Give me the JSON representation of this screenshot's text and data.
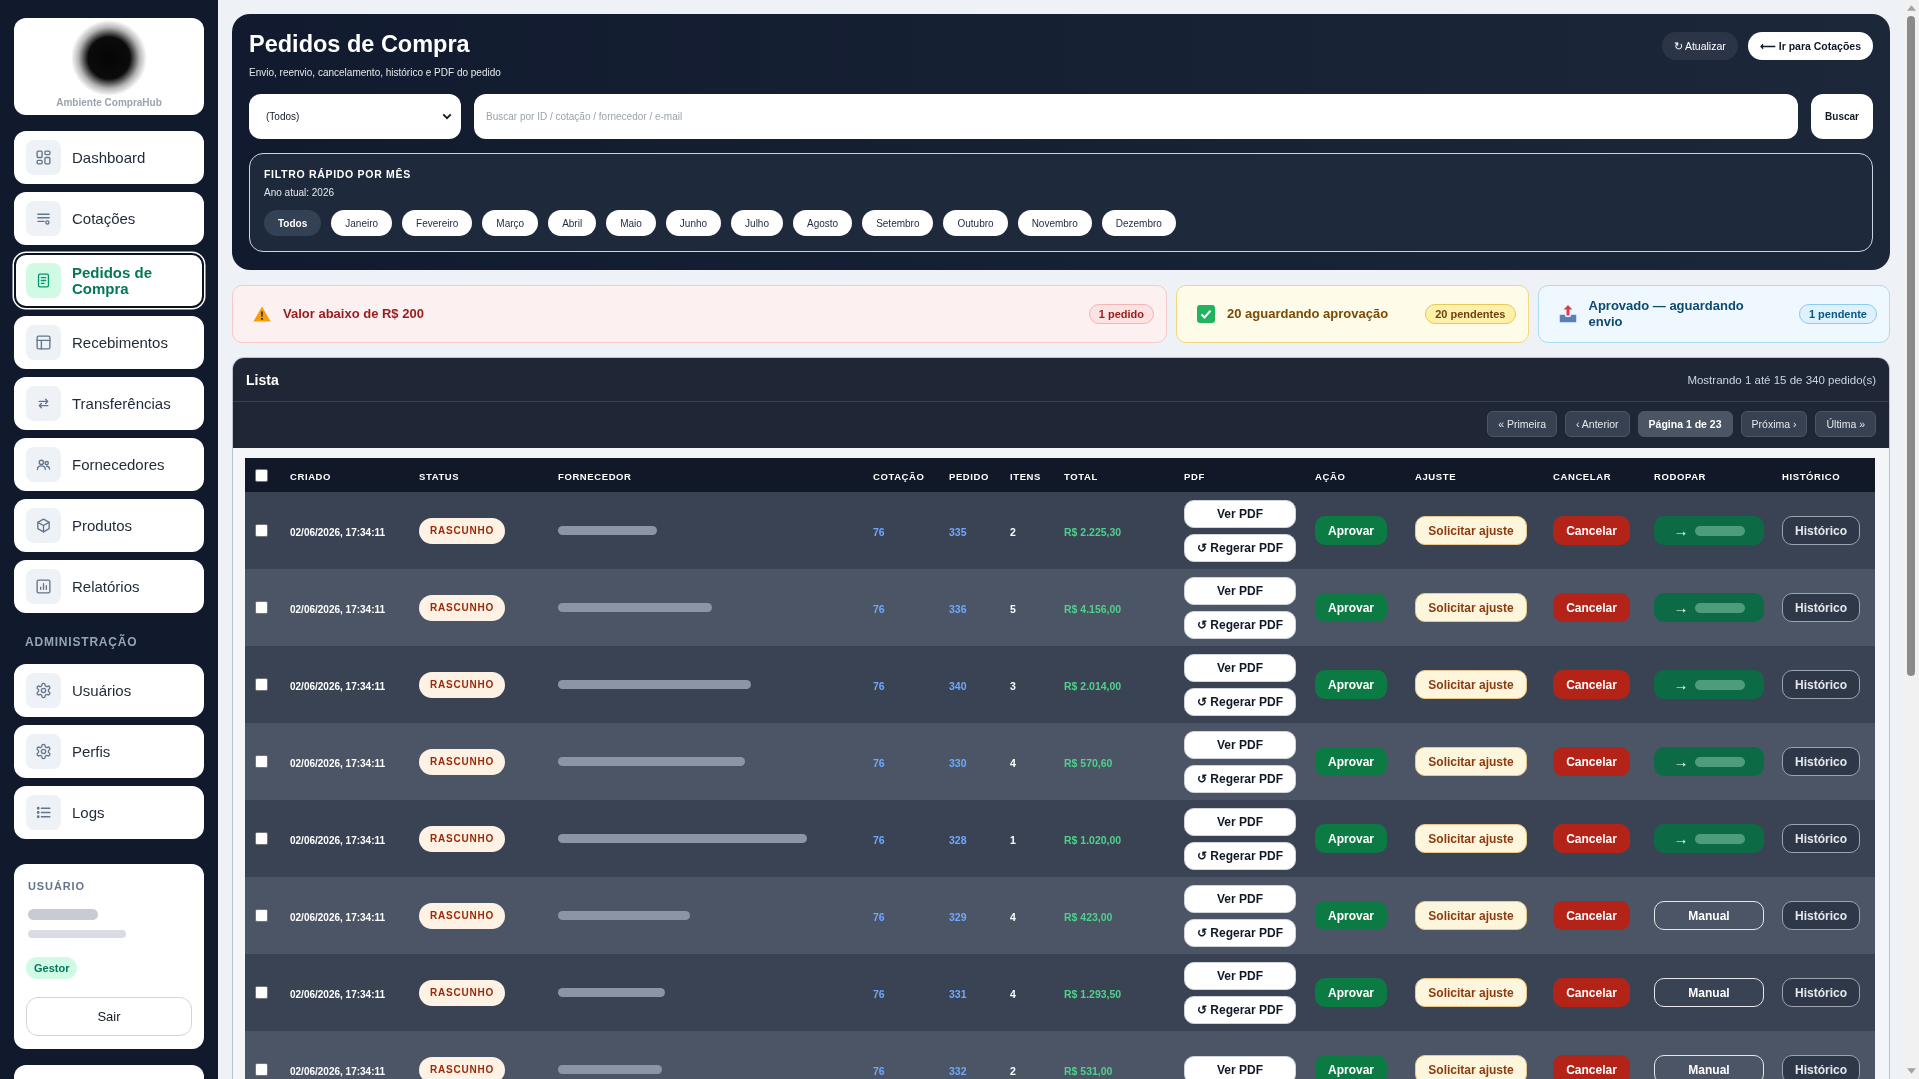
{
  "sidebar": {
    "brand_caption": "Ambiente CompraHub",
    "sections": [
      {
        "items": [
          {
            "label": "Dashboard",
            "selected": false
          },
          {
            "label": "Cotações",
            "selected": false
          },
          {
            "label": "Pedidos de Compra",
            "selected": true
          },
          {
            "label": "Recebimentos",
            "selected": false
          },
          {
            "label": "Transferências",
            "selected": false
          },
          {
            "label": "Fornecedores",
            "selected": false
          },
          {
            "label": "Produtos",
            "selected": false
          },
          {
            "label": "Relatórios",
            "selected": false
          }
        ]
      },
      {
        "heading": "ADMINISTRAÇÃO",
        "items": [
          {
            "label": "Usuários",
            "selected": false
          },
          {
            "label": "Perfis",
            "selected": false
          },
          {
            "label": "Logs",
            "selected": false
          }
        ]
      }
    ],
    "user": {
      "heading": "USUÁRIO",
      "role": "Gestor",
      "logout": "Sair"
    }
  },
  "header": {
    "title": "Pedidos de Compra",
    "subtitle": "Envio, reenvio, cancelamento, histórico e PDF do pedido",
    "actions": [
      {
        "kind": "dark",
        "label": "↻ Atualizar"
      },
      {
        "kind": "light",
        "label": "⟵ Ir para Cotações"
      }
    ],
    "status_select": {
      "value": "(Todos)"
    },
    "search": {
      "placeholder": "Buscar por ID / cotação / fornecedor / e-mail",
      "button": "Buscar"
    },
    "month_filter": {
      "heading": "FILTRO RÁPIDO POR MÊS",
      "year_note": "Ano atual: 2026",
      "months": [
        {
          "label": "Todos",
          "selected": true
        },
        {
          "label": "Janeiro",
          "selected": false
        },
        {
          "label": "Fevereiro",
          "selected": false
        },
        {
          "label": "Março",
          "selected": false
        },
        {
          "label": "Abril",
          "selected": false
        },
        {
          "label": "Maio",
          "selected": false
        },
        {
          "label": "Junho",
          "selected": false
        },
        {
          "label": "Julho",
          "selected": false
        },
        {
          "label": "Agosto",
          "selected": false
        },
        {
          "label": "Setembro",
          "selected": false
        },
        {
          "label": "Outubro",
          "selected": false
        },
        {
          "label": "Novembro",
          "selected": false
        },
        {
          "label": "Dezembro",
          "selected": false
        }
      ]
    }
  },
  "alerts": [
    {
      "kind": "danger",
      "text": "Valor abaixo de R$ 200",
      "badge": "1 pedido"
    },
    {
      "kind": "warning",
      "text": "20 aguardando aprovação",
      "badge": "20 pendentes"
    },
    {
      "kind": "info",
      "text": "Aprovado — aguardando envio",
      "badge": "1 pendente"
    }
  ],
  "list": {
    "title": "Lista",
    "summary": "Mostrando 1 até 15 de 340 pedido(s)",
    "pagination": [
      {
        "kind": "nav",
        "label": "« Primeira"
      },
      {
        "kind": "nav",
        "label": "‹ Anterior"
      },
      {
        "kind": "page",
        "label": "Página 1 de 23"
      },
      {
        "kind": "nav",
        "label": "Próxima ›"
      },
      {
        "kind": "nav",
        "label": "Última »"
      }
    ],
    "table": {
      "select_all_checked": false,
      "columns": [
        "CRIADO",
        "STATUS",
        "FORNECEDOR",
        "COTAÇÃO",
        "PEDIDO",
        "ITENS",
        "TOTAL",
        "PDF",
        "AÇÃO",
        "AJUSTE",
        "CANCELAR",
        "RODOPAR",
        "HISTÓRICO"
      ],
      "rows": [
        {
          "checked": false,
          "created": "02/06/2026, 17:34:11",
          "status": "RASCUNHO",
          "quote": "76",
          "order": "335",
          "items": "2",
          "total": "R$ 2.225,30",
          "pdf": [
            "Ver PDF",
            "↺ Regerar PDF"
          ],
          "approve": "Aprovar",
          "adjust": "Solicitar ajuste",
          "cancel": "Cancelar",
          "rodopar": {
            "kind": "send",
            "label": "→"
          },
          "history": "Histórico"
        },
        {
          "checked": false,
          "created": "02/06/2026, 17:34:11",
          "status": "RASCUNHO",
          "quote": "76",
          "order": "336",
          "items": "5",
          "total": "R$ 4.156,00",
          "pdf": [
            "Ver PDF",
            "↺ Regerar PDF"
          ],
          "approve": "Aprovar",
          "adjust": "Solicitar ajuste",
          "cancel": "Cancelar",
          "rodopar": {
            "kind": "send",
            "label": "→"
          },
          "history": "Histórico"
        },
        {
          "checked": false,
          "created": "02/06/2026, 17:34:11",
          "status": "RASCUNHO",
          "quote": "76",
          "order": "340",
          "items": "3",
          "total": "R$ 2.014,00",
          "pdf": [
            "Ver PDF",
            "↺ Regerar PDF"
          ],
          "approve": "Aprovar",
          "adjust": "Solicitar ajuste",
          "cancel": "Cancelar",
          "rodopar": {
            "kind": "send",
            "label": "→"
          },
          "history": "Histórico"
        },
        {
          "checked": false,
          "created": "02/06/2026, 17:34:11",
          "status": "RASCUNHO",
          "quote": "76",
          "order": "330",
          "items": "4",
          "total": "R$ 570,60",
          "pdf": [
            "Ver PDF",
            "↺ Regerar PDF"
          ],
          "approve": "Aprovar",
          "adjust": "Solicitar ajuste",
          "cancel": "Cancelar",
          "rodopar": {
            "kind": "send",
            "label": "→"
          },
          "history": "Histórico"
        },
        {
          "checked": false,
          "created": "02/06/2026, 17:34:11",
          "status": "RASCUNHO",
          "quote": "76",
          "order": "328",
          "items": "1",
          "total": "R$ 1.020,00",
          "pdf": [
            "Ver PDF",
            "↺ Regerar PDF"
          ],
          "approve": "Aprovar",
          "adjust": "Solicitar ajuste",
          "cancel": "Cancelar",
          "rodopar": {
            "kind": "send",
            "label": "→"
          },
          "history": "Histórico"
        },
        {
          "checked": false,
          "created": "02/06/2026, 17:34:11",
          "status": "RASCUNHO",
          "quote": "76",
          "order": "329",
          "items": "4",
          "total": "R$ 423,00",
          "pdf": [
            "Ver PDF",
            "↺ Regerar PDF"
          ],
          "approve": "Aprovar",
          "adjust": "Solicitar ajuste",
          "cancel": "Cancelar",
          "rodopar": {
            "kind": "manual",
            "label": "Manual"
          },
          "history": "Histórico"
        },
        {
          "checked": false,
          "created": "02/06/2026, 17:34:11",
          "status": "RASCUNHO",
          "quote": "76",
          "order": "331",
          "items": "4",
          "total": "R$ 1.293,50",
          "pdf": [
            "Ver PDF",
            "↺ Regerar PDF"
          ],
          "approve": "Aprovar",
          "adjust": "Solicitar ajuste",
          "cancel": "Cancelar",
          "rodopar": {
            "kind": "manual",
            "label": "Manual"
          },
          "history": "Histórico"
        },
        {
          "checked": false,
          "created": "02/06/2026, 17:34:11",
          "status": "RASCUNHO",
          "quote": "76",
          "order": "332",
          "items": "2",
          "total": "R$ 531,00",
          "pdf": [
            "Ver PDF"
          ],
          "approve": "Aprovar",
          "adjust": "Solicitar ajuste",
          "cancel": "Cancelar",
          "rodopar": {
            "kind": "manual",
            "label": "Manual"
          },
          "history": "Histórico"
        }
      ]
    }
  }
}
